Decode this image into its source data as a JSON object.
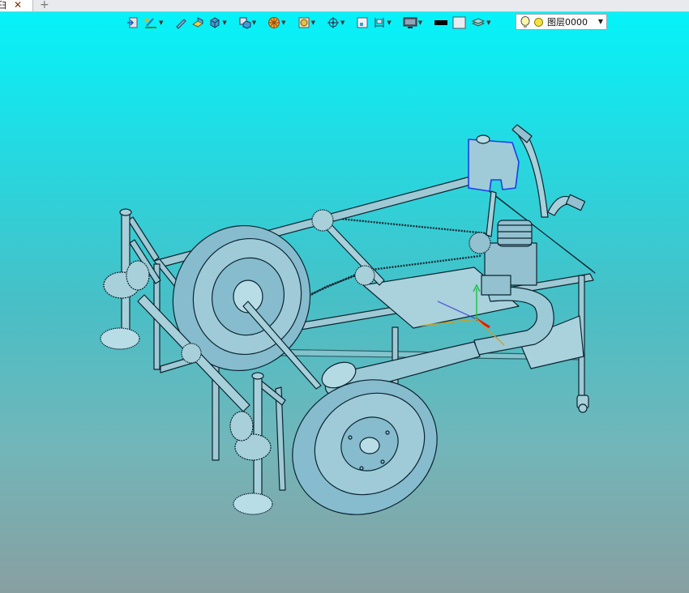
{
  "tab": {
    "label": "臼",
    "close_glyph": "✕",
    "new_glyph": "+"
  },
  "layer": {
    "name": "图层0000",
    "arrow": "▼"
  },
  "colors": {
    "viewport_top": "#05f3f9",
    "viewport_bottom": "#889fa1",
    "model_fill": "#7fb7c8",
    "model_line": "#0b2430",
    "highlight": "#1c3cf0"
  },
  "icons": [
    "import-icon",
    "sketch-icon",
    "pencil-icon",
    "prism-icon",
    "cube-icon",
    "block-icon",
    "wheel-icon",
    "shape-icon",
    "move-icon",
    "frame-icon",
    "dimension-icon",
    "display-icon",
    "black-color-icon",
    "white-color-icon",
    "layer-stack-icon"
  ]
}
